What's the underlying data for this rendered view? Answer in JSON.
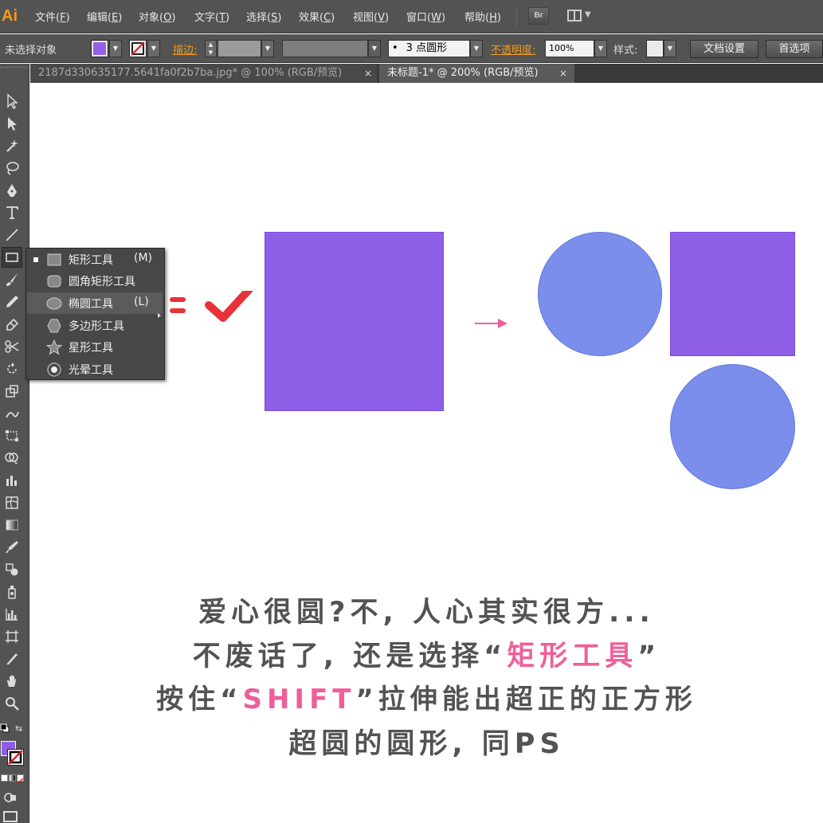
{
  "app": {
    "logo": "Ai"
  },
  "menu": [
    {
      "label": "文件(",
      "key": "F",
      "tail": ")"
    },
    {
      "label": "编辑(",
      "key": "E",
      "tail": ")"
    },
    {
      "label": "对象(",
      "key": "O",
      "tail": ")"
    },
    {
      "label": "文字(",
      "key": "T",
      "tail": ")"
    },
    {
      "label": "选择(",
      "key": "S",
      "tail": ")"
    },
    {
      "label": "效果(",
      "key": "C",
      "tail": ")"
    },
    {
      "label": "视图(",
      "key": "V",
      "tail": ")"
    },
    {
      "label": "窗口(",
      "key": "W",
      "tail": ")"
    },
    {
      "label": "帮助(",
      "key": "H",
      "tail": ")"
    }
  ],
  "bridge_label": "Br",
  "control": {
    "selection_status": "未选择对象",
    "fill_color": "#9461e6",
    "stroke_label": "描边:",
    "profile_label": "3 点圆形",
    "opacity_label": "不透明度:",
    "opacity_value": "100%",
    "style_label": "样式:",
    "doc_setup": "文档设置",
    "preferences": "首选项"
  },
  "tabs": [
    {
      "label": "2187d330635177.5641fa0f2b7ba.jpg* @ 100% (RGB/预览)",
      "active": false
    },
    {
      "label": "未标题-1* @ 200% (RGB/预览)",
      "active": true
    }
  ],
  "tab_close": "×",
  "flyout": {
    "items": [
      {
        "label": "矩形工具",
        "key": "(M)",
        "icon": "rectangle-icon",
        "current": true,
        "highlighted": false
      },
      {
        "label": "圆角矩形工具",
        "key": "",
        "icon": "rounded-rectangle-icon",
        "current": false,
        "highlighted": false
      },
      {
        "label": "椭圆工具",
        "key": "(L)",
        "icon": "ellipse-icon",
        "current": false,
        "highlighted": true
      },
      {
        "label": "多边形工具",
        "key": "",
        "icon": "polygon-icon",
        "current": false,
        "highlighted": false
      },
      {
        "label": "星形工具",
        "key": "",
        "icon": "star-icon",
        "current": false,
        "highlighted": false
      },
      {
        "label": "光晕工具",
        "key": "",
        "icon": "flare-icon",
        "current": false,
        "highlighted": false
      }
    ]
  },
  "colors": {
    "purple": "#8f5ee6",
    "blue": "#7b8eeb",
    "pink": "#ee5f9a",
    "red_mark": "#e8323a"
  },
  "caption": {
    "line1": "爱心很圆?不, 人心其实很方...",
    "line2_pre": "不废话了, 还是选择“",
    "line2_hl": "矩形工具",
    "line2_post": "”",
    "line3_pre": "按住“",
    "line3_hl": "SHIFT",
    "line3_post": "”拉伸能出超正的正方形",
    "line4": "超圆的圆形, 同PS"
  }
}
